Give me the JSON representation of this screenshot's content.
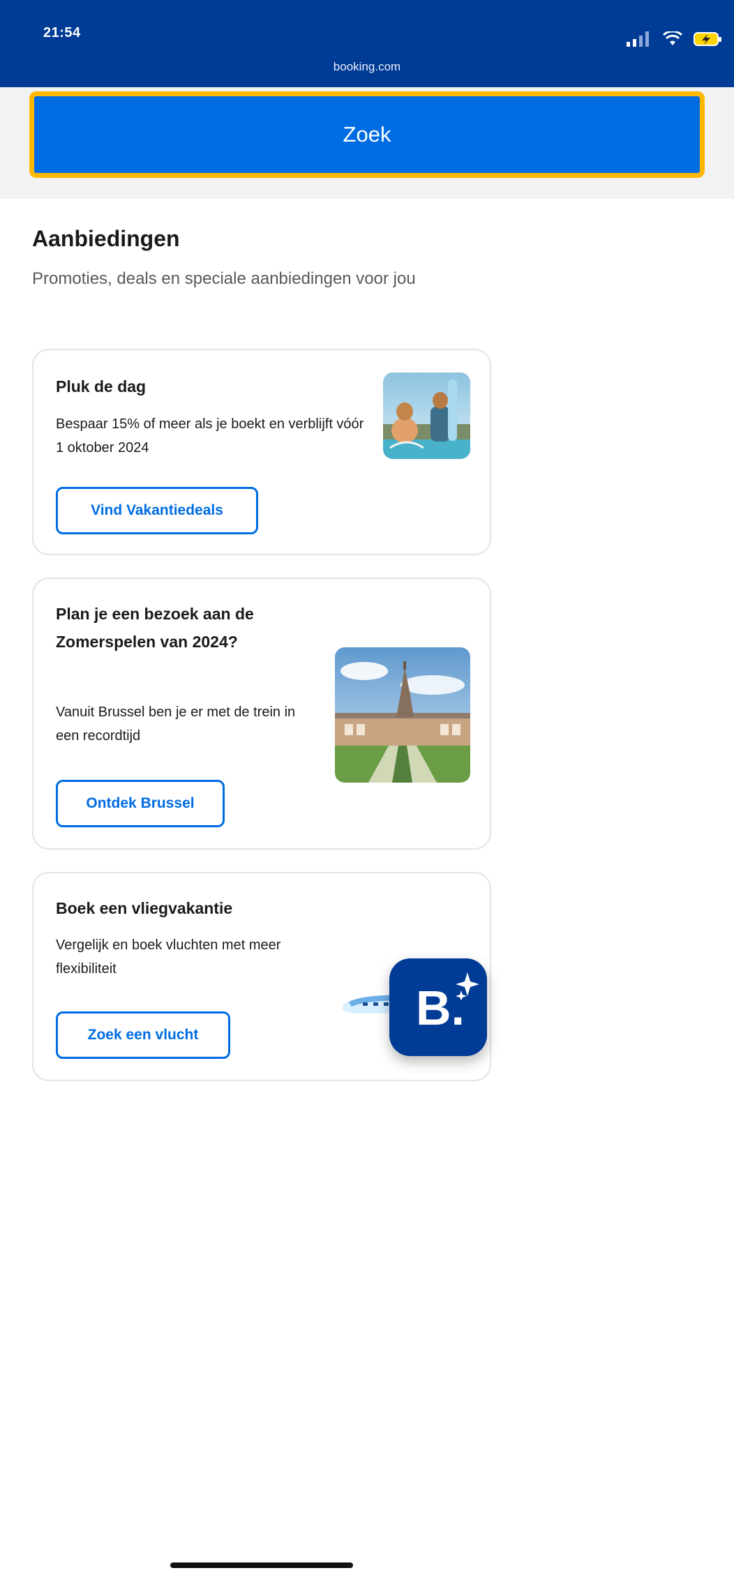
{
  "status_bar": {
    "time": "21:54",
    "url": "booking.com"
  },
  "search": {
    "button_label": "Zoek"
  },
  "offers": {
    "title": "Aanbiedingen",
    "subtitle": "Promoties, deals en speciale aanbiedingen voor jou",
    "cards": [
      {
        "title": "Pluk de dag",
        "text": "Bespaar 15% of meer als je boekt en verblijft vóór 1 oktober 2024",
        "button_label": "Vind Vakantiedeals"
      },
      {
        "title": "Plan je een bezoek aan de Zomerspelen van 2024?",
        "text": "Vanuit Brussel ben je er met de trein in een recordtijd",
        "button_label": "Ontdek Brussel"
      },
      {
        "title": "Boek een vliegvakantie",
        "text": "Vergelijk en boek vluchten met meer flexibiliteit",
        "button_label": "Zoek een vlucht"
      }
    ]
  },
  "fab": {
    "logo_text": "B."
  },
  "colors": {
    "header_blue": "#003b95",
    "button_blue": "#006ce4",
    "search_border": "#ffb700",
    "card_border": "#e4e4e4"
  }
}
